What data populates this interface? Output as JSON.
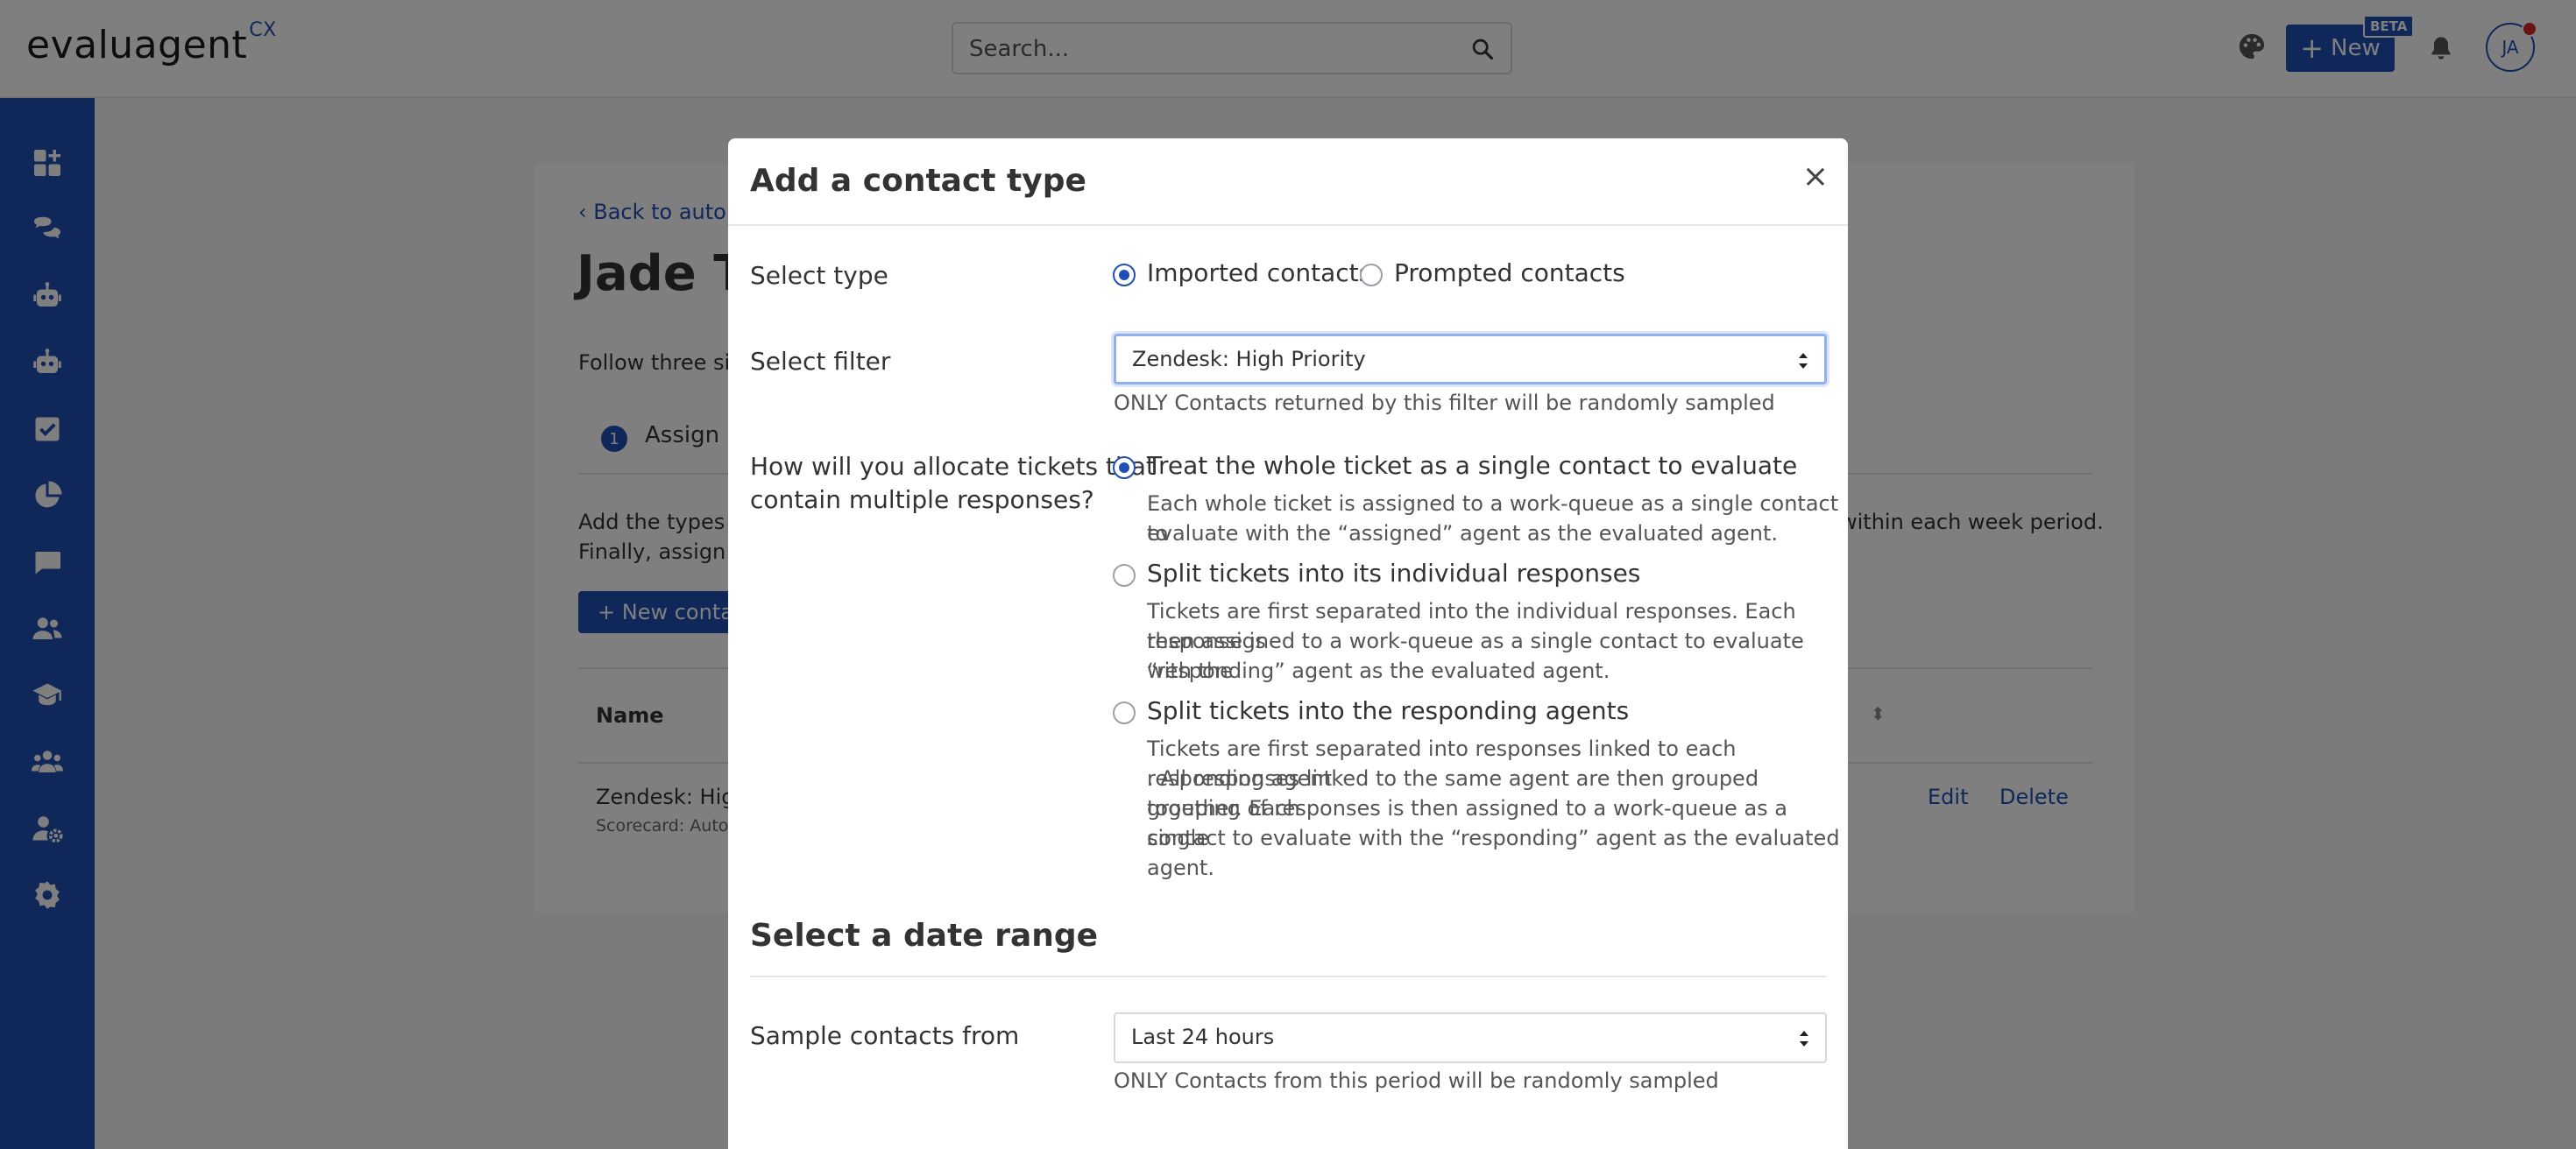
{
  "app": {
    "logo_text": "evaluagent",
    "logo_suffix": "CX"
  },
  "topbar": {
    "search_placeholder": "Search...",
    "new_label": "New",
    "beta_label": "BETA",
    "avatar_initials": "JA"
  },
  "background": {
    "back_link": "Back to auto w",
    "title": "Jade Te",
    "follow_text": "Follow three sim",
    "step_number": "1",
    "step_label": "Assign a",
    "add_text": "Add the types of",
    "final_text": "Finally, assign th",
    "week_text": "within each week period.",
    "new_contact_label": "New conta",
    "table_header_name": "Name",
    "row_name": "Zendesk: High",
    "row_scorecard": "Scorecard: AutoP",
    "edit_label": "Edit",
    "delete_label": "Delete"
  },
  "modal": {
    "title": "Add a contact type",
    "close_label": "×",
    "select_type_label": "Select type",
    "type_options": [
      {
        "label": "Imported contacts",
        "selected": true
      },
      {
        "label": "Prompted contacts",
        "selected": false
      }
    ],
    "select_filter_label": "Select filter",
    "filter_value": "Zendesk: High Priority",
    "filter_help": "ONLY Contacts returned by this filter will be randomly sampled",
    "allocate_label_line1": "How will you allocate tickets that",
    "allocate_label_line2": "contain multiple responses?",
    "allocate_options": [
      {
        "label": "Treat the whole ticket as a single contact to evaluate",
        "selected": true,
        "desc": [
          "Each whole ticket is assigned to a work-queue as a single contact to",
          "evaluate with the “assigned” agent as the evaluated agent."
        ]
      },
      {
        "label": "Split tickets into its individual responses",
        "selected": false,
        "desc": [
          "Tickets are first separated into the individual responses. Each response is",
          "then assigned to a work-queue as a single contact to evaluate with the",
          "“responding” agent as the evaluated agent."
        ]
      },
      {
        "label": "Split tickets into the responding agents",
        "selected": false,
        "desc": [
          "Tickets are first separated into responses linked to each responding agent",
          ". All responses linked to the same agent are then grouped together. Each",
          "grouping of responses is then assigned to a work-queue as a single",
          "contact to evaluate with the “responding” agent as the evaluated agent."
        ]
      }
    ],
    "date_section_title": "Select a date range",
    "sample_from_label": "Sample contacts from",
    "sample_from_value": "Last 24 hours",
    "sample_help": "ONLY Contacts from this period will be randomly sampled"
  },
  "colors": {
    "brand": "#1f4fb3",
    "alert": "#d62828"
  }
}
